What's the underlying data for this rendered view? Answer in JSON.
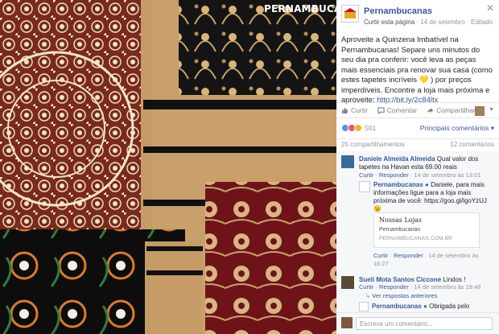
{
  "photo": {
    "watermark": "PERNAMBUCANAS"
  },
  "post": {
    "page_name": "Pernambucanas",
    "meta_like": "Curtir esta página",
    "meta_date": "14 de setembro",
    "meta_edited": "Editado",
    "globe": "·",
    "text_main": "Aproveite a Quinzena Imbatível na Pernambucanas! Separe uns minutos do seu dia pra conferir: você leva as peças mais essenciais pra renovar sua casa (como estes tapetes incríveis",
    "emoji": "💛",
    "text_tail": ") por preços imperdíveis. Encontre a loja mais próxima e aproveite: ",
    "url": "http://bit.ly/2c84ltx"
  },
  "actions": {
    "like": "Curtir",
    "comment": "Comentar",
    "share": "Compartilhar"
  },
  "reactions": {
    "count": "501",
    "relevant": "Principais comentários ▾"
  },
  "shares": {
    "shares": "25 compartilhamentos",
    "comments": "12 comentários"
  },
  "comments": [
    {
      "name": "Daniele Almeida Almeida",
      "text": "Qual valor dos tapetes na Havan esta 69.00 reais",
      "like": "Curtir",
      "reply": "Responder",
      "date": "14 de setembro às 13:01"
    },
    {
      "name": "Pernambucanas",
      "text": "Daniele, para mais informações ligue para a loja mais próxima de você: https://goo.gl/lgoYzUJ",
      "emoji": "😉",
      "like": "Curtir",
      "reply": "Responder",
      "date": "14 de setembro às 16:27",
      "card": {
        "title": "Nossas Lojas",
        "sub": "Pernambucanas",
        "domain": "PERNAMBUCANAS.COM.BR"
      }
    },
    {
      "name": "Sueli Mota Santos Ciccone",
      "text": "Lindos !",
      "like": "Curtir",
      "reply": "Responder",
      "date": "14 de setembro às 19:48",
      "more": "Ver respostas anteriores"
    },
    {
      "name": "Pernambucanas",
      "text": "Obrigada pelo"
    }
  ],
  "write": {
    "placeholder": "Escreva um comentário..."
  },
  "colors": {
    "link": "#365899",
    "muted": "#90949c",
    "like_blue": "#598eff",
    "love_red": "#f25268",
    "haha_yellow": "#f7b125"
  }
}
